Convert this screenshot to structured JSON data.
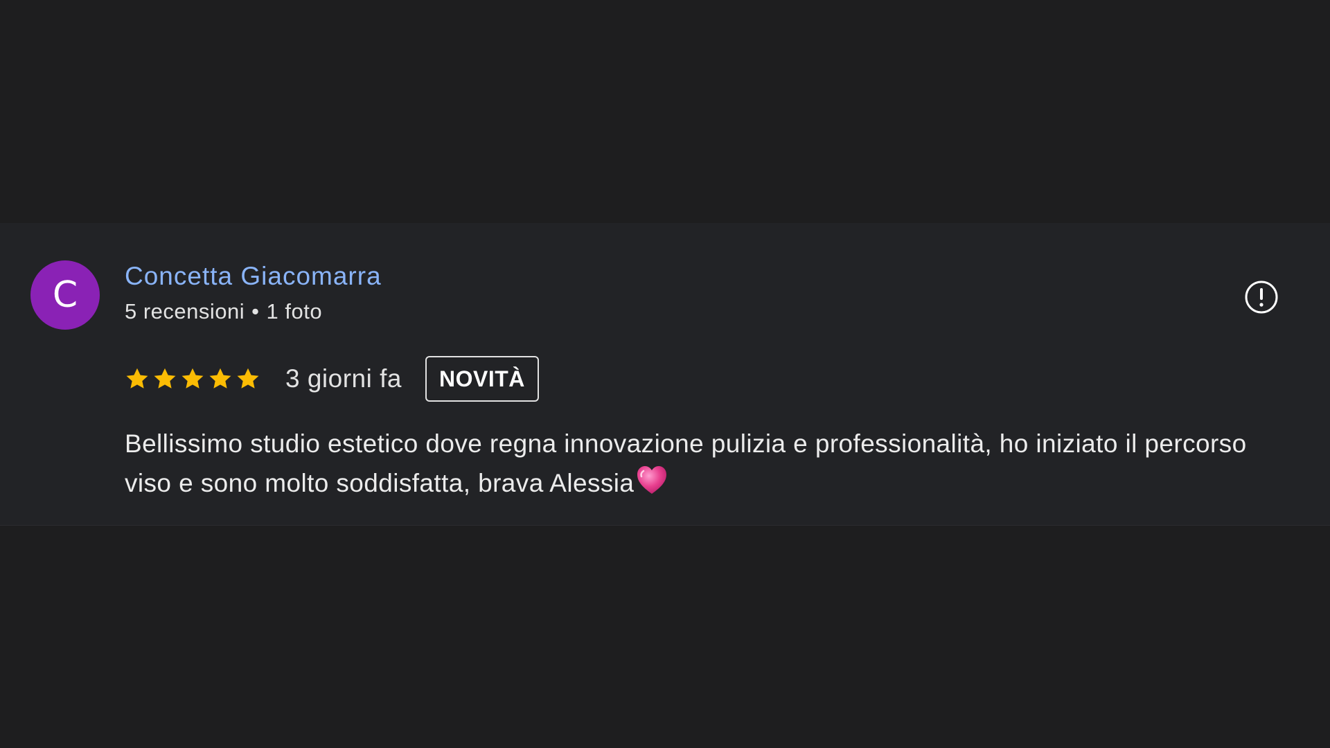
{
  "review": {
    "avatar_initial": "C",
    "avatar_color": "#8a22b5",
    "reviewer_name": "Concetta Giacomarra",
    "reviews_count": "5 recensioni",
    "separator": "•",
    "photos_count": "1 foto",
    "rating": 5,
    "rating_max": 5,
    "date": "3 giorni fa",
    "badge": "NOVITÀ",
    "text": "Bellissimo studio estetico dove regna innovazione pulizia e professionalità, ho iniziato il percorso viso e sono molto soddisfatta, brava Alessia",
    "text_trailing_icon": "pink-heart-icon",
    "report_icon": "exclamation-circle-icon"
  },
  "colors": {
    "background": "#1e1e1f",
    "card": "#222326",
    "name_link": "#8ab4f8",
    "star": "#fbbc04",
    "text": "#e3e3e3"
  }
}
